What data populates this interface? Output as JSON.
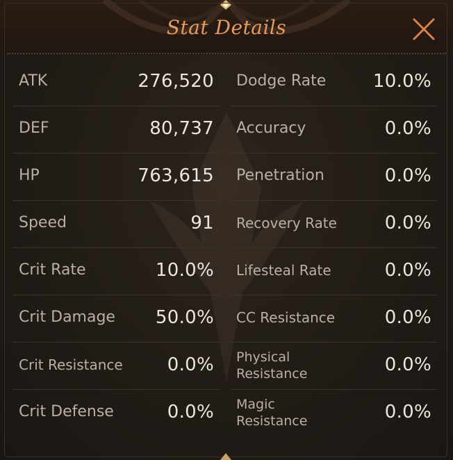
{
  "window": {
    "title": "Stat Details"
  },
  "stats_left": [
    {
      "label": "ATK",
      "value": "276,520"
    },
    {
      "label": "DEF",
      "value": "80,737"
    },
    {
      "label": "HP",
      "value": "763,615"
    },
    {
      "label": "Speed",
      "value": "91"
    },
    {
      "label": "Crit Rate",
      "value": "10.0%"
    },
    {
      "label": "Crit Damage",
      "value": "50.0%"
    },
    {
      "label": "Crit Resistance",
      "value": "0.0%"
    },
    {
      "label": "Crit Defense",
      "value": "0.0%"
    }
  ],
  "stats_right": [
    {
      "label": "Dodge Rate",
      "value": "10.0%"
    },
    {
      "label": "Accuracy",
      "value": "0.0%"
    },
    {
      "label": "Penetration",
      "value": "0.0%"
    },
    {
      "label": "Recovery Rate",
      "value": "0.0%"
    },
    {
      "label": "Lifesteal Rate",
      "value": "0.0%"
    },
    {
      "label": "CC Resistance",
      "value": "0.0%"
    },
    {
      "label_line1": "Physical",
      "label_line2": "Resistance",
      "value": "0.0%"
    },
    {
      "label_line1": "Magic",
      "label_line2": "Resistance",
      "value": "0.0%"
    }
  ],
  "icons": {
    "close": "close-icon",
    "gem_top": "diamond-ornament-icon",
    "gem_bottom": "diamond-ornament-icon",
    "watermark": "crest-emblem-icon"
  },
  "colors": {
    "title": "#e69b5f",
    "label": "#b9b0a6",
    "value": "#ece6df",
    "divider": "#3c332b",
    "close": "#d9834a"
  }
}
